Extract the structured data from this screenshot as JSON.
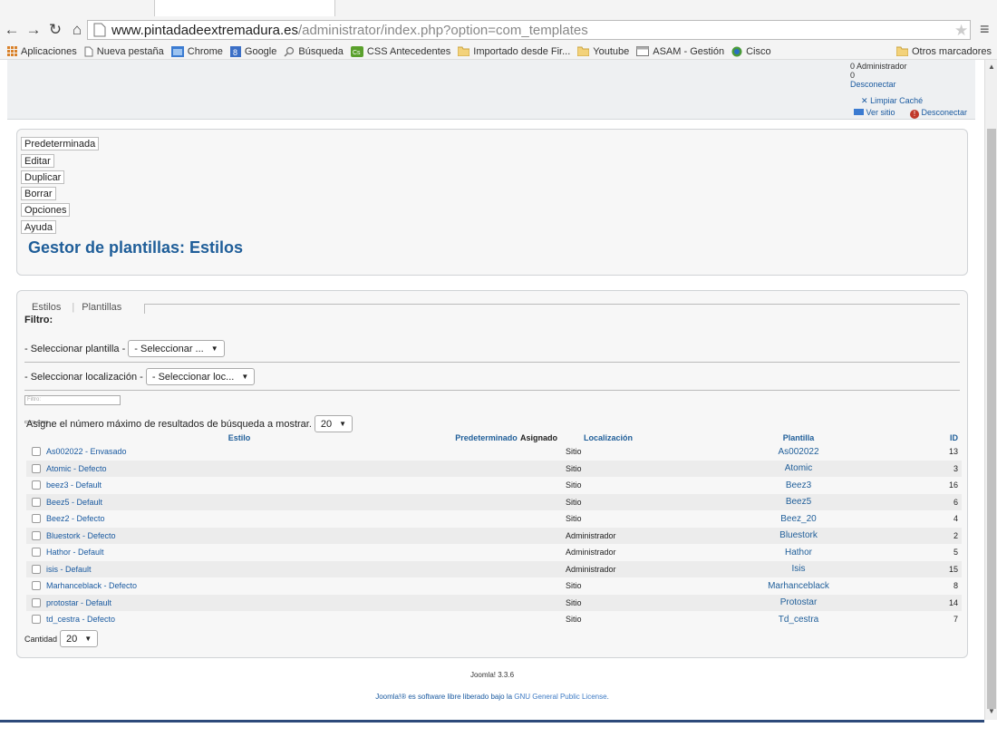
{
  "browser": {
    "url_host": "www.pintadadeextremadura.es",
    "url_path": "/administrator/index.php?option=com_templates",
    "bookmarks": [
      {
        "label": "Aplicaciones",
        "icon": "apps-grid-icon"
      },
      {
        "label": "Nueva pestaña",
        "icon": "page-icon"
      },
      {
        "label": "Chrome",
        "icon": "chrome-icon"
      },
      {
        "label": "Google",
        "icon": "google-icon"
      },
      {
        "label": "Búsqueda",
        "icon": "search-icon"
      },
      {
        "label": "CSS Antecedentes",
        "icon": "css-icon"
      },
      {
        "label": "Importado desde Fir...",
        "icon": "folder-icon"
      },
      {
        "label": "Youtube",
        "icon": "folder-icon"
      },
      {
        "label": "ASAM - Gestión",
        "icon": "window-icon"
      },
      {
        "label": "Cisco",
        "icon": "globe-icon"
      }
    ],
    "other_bookmarks": "Otros marcadores"
  },
  "header": {
    "user_line1": "0 Administrador",
    "user_line2": "0 ",
    "user_line3": "Desconectar",
    "clear_cache": "Limpiar Caché",
    "view_site": "Ver sitio",
    "logout": "Desconectar"
  },
  "toolbar": {
    "buttons": [
      "Predeterminada",
      "Editar",
      "Duplicar",
      "Borrar",
      "Opciones",
      "Ayuda"
    ],
    "title": "Gestor de plantillas: Estilos"
  },
  "main": {
    "tabs": [
      "Estilos",
      "Plantillas"
    ],
    "filter_label": "Filtro:",
    "template_filter_label": "- Seleccionar plantilla -",
    "template_filter_value": "- Seleccionar ...",
    "location_filter_label": "- Seleccionar localización -",
    "location_filter_value": "- Seleccionar loc...",
    "search_placeholder": "Filtro:",
    "limit_label": "Asigne el número máximo de resultados de búsqueda a mostrar.",
    "limit_value": "20",
    "columns": {
      "style": "Estilo",
      "default": "Predeterminado",
      "assigned": "Asignado",
      "location": "Localización",
      "template": "Plantilla",
      "id": "ID"
    },
    "rows": [
      {
        "style": "As002022 - Envasado",
        "location": "Sitio",
        "template": "As002022",
        "id": "13"
      },
      {
        "style": "Atomic - Defecto",
        "location": "Sitio",
        "template": "Atomic",
        "id": "3"
      },
      {
        "style": "beez3 - Default",
        "location": "Sitio",
        "template": "Beez3",
        "id": "16"
      },
      {
        "style": "Beez5 - Default",
        "location": "Sitio",
        "template": "Beez5",
        "id": "6"
      },
      {
        "style": "Beez2 - Defecto",
        "location": "Sitio",
        "template": "Beez_20",
        "id": "4"
      },
      {
        "style": "Bluestork - Defecto",
        "location": "Administrador",
        "template": "Bluestork",
        "id": "2"
      },
      {
        "style": "Hathor - Default",
        "location": "Administrador",
        "template": "Hathor",
        "id": "5"
      },
      {
        "style": "isis - Default",
        "location": "Administrador",
        "template": "Isis",
        "id": "15"
      },
      {
        "style": "Marhanceblack - Defecto",
        "location": "Sitio",
        "template": "Marhanceblack",
        "id": "8"
      },
      {
        "style": "protostar - Default",
        "location": "Sitio",
        "template": "Protostar",
        "id": "14"
      },
      {
        "style": "td_cestra - Defecto",
        "location": "Sitio",
        "template": "Td_cestra",
        "id": "7"
      }
    ],
    "quantity_label": "Cantidad",
    "quantity_value": "20"
  },
  "footer": {
    "version": "Joomla! 3.3.6",
    "license_prefix": "Joomla!® es software libre liberado bajo la",
    "license_link": "GNU General Public License",
    "license_suffix": "."
  },
  "colors": {
    "accent": "#1f5e99",
    "link": "#1a5aa0",
    "danger": "#c0392b"
  }
}
